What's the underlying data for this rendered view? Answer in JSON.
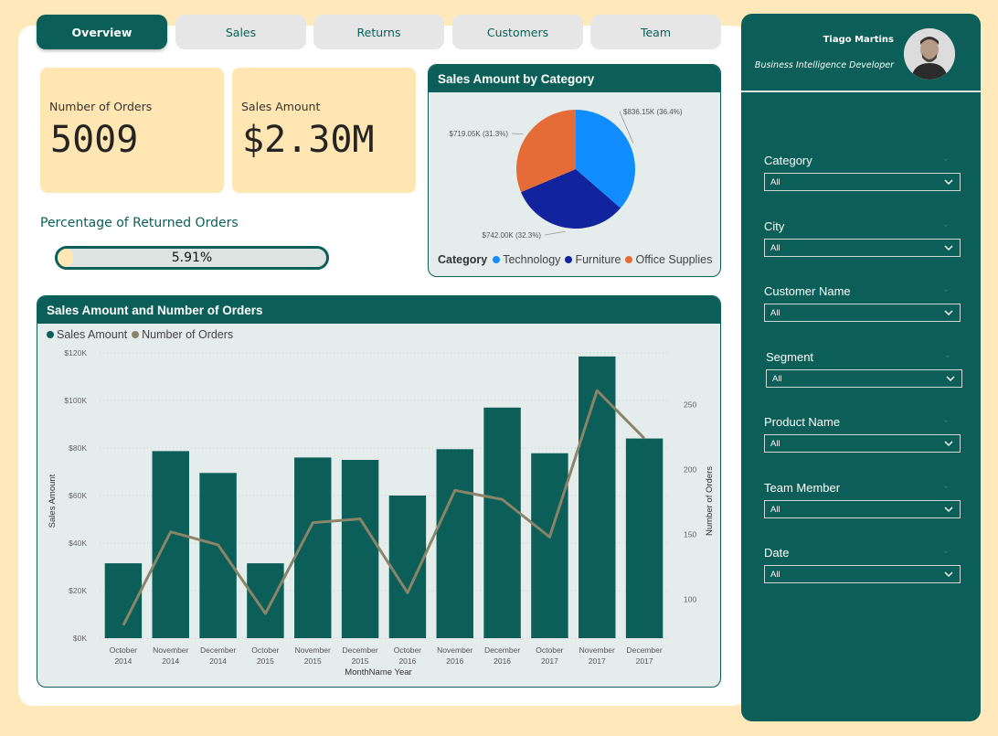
{
  "tabs": [
    {
      "label": "Overview",
      "active": true
    },
    {
      "label": "Sales",
      "active": false
    },
    {
      "label": "Returns",
      "active": false
    },
    {
      "label": "Customers",
      "active": false
    },
    {
      "label": "Team",
      "active": false
    }
  ],
  "kpis": {
    "orders_label": "Number of Orders",
    "orders_value": "5009",
    "sales_label": "Sales Amount",
    "sales_value": "$2.30M"
  },
  "returned": {
    "title": "Percentage of Returned Orders",
    "value_text": "5.91%",
    "fraction": 0.0591
  },
  "user": {
    "name": "Tiago Martins",
    "role": "Business Intelligence Developer"
  },
  "slicers": [
    {
      "label": "Category",
      "value": "All"
    },
    {
      "label": "City",
      "value": "All"
    },
    {
      "label": "Customer Name",
      "value": "All"
    },
    {
      "label": "Segment",
      "value": "All"
    },
    {
      "label": "Product Name",
      "value": "All"
    },
    {
      "label": "Team Member",
      "value": "All"
    },
    {
      "label": "Date",
      "value": "All"
    }
  ],
  "colors": {
    "accent": "#0B5F58",
    "panel": "#0B5F58",
    "kpi_bg": "#FFE6B2",
    "page_bg": "#FFE9BA",
    "technology": "#118DFF",
    "furniture": "#12239E",
    "office_supplies": "#E66C37",
    "line": "#8A8468"
  },
  "chart_data": [
    {
      "type": "pie",
      "title": "Sales Amount by Category",
      "legend_title": "Category",
      "legend_position": "bottom",
      "slices": [
        {
          "name": "Technology",
          "value": 836.15,
          "label": "$836.15K (36.4%)",
          "color": "#118DFF"
        },
        {
          "name": "Furniture",
          "value": 742.0,
          "label": "$742.00K (32.3%)",
          "color": "#12239E"
        },
        {
          "name": "Office Supplies",
          "value": 719.05,
          "label": "$719.05K (31.3%)",
          "color": "#E66C37"
        }
      ]
    },
    {
      "type": "bar",
      "title": "Sales Amount and Number of Orders",
      "xlabel": "MonthName Year",
      "ylabel": "Sales Amount",
      "y2label": "Number of Orders",
      "legend_position": "top-left",
      "categories": [
        [
          "October",
          "2014"
        ],
        [
          "November",
          "2014"
        ],
        [
          "December",
          "2014"
        ],
        [
          "October",
          "2015"
        ],
        [
          "November",
          "2015"
        ],
        [
          "December",
          "2015"
        ],
        [
          "October",
          "2016"
        ],
        [
          "November",
          "2016"
        ],
        [
          "December",
          "2016"
        ],
        [
          "October",
          "2017"
        ],
        [
          "November",
          "2017"
        ],
        [
          "December",
          "2017"
        ]
      ],
      "ylim": [
        0,
        120000
      ],
      "yticks": [
        0,
        20000,
        40000,
        60000,
        80000,
        100000,
        120000
      ],
      "ytick_labels": [
        "$0K",
        "$20K",
        "$40K",
        "$60K",
        "$80K",
        "$100K",
        "$120K"
      ],
      "y2lim": [
        70,
        290
      ],
      "y2ticks": [
        100,
        150,
        200,
        250
      ],
      "grid": true,
      "series": [
        {
          "name": "Sales Amount",
          "kind": "bar",
          "axis": "y",
          "color": "#0B5F58",
          "values": [
            31500,
            78700,
            69500,
            31500,
            76000,
            75000,
            60000,
            79500,
            97000,
            77800,
            118500,
            84000
          ]
        },
        {
          "name": "Number of Orders",
          "kind": "line",
          "axis": "y2",
          "color": "#8A8468",
          "values": [
            80,
            152,
            142,
            89,
            159,
            162,
            105,
            184,
            177,
            148,
            261,
            224
          ]
        }
      ]
    }
  ]
}
